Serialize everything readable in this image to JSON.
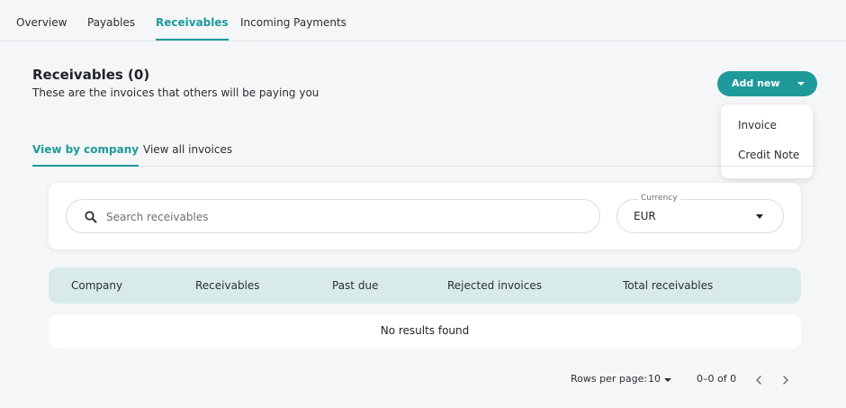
{
  "top_tabs": [
    {
      "label": "Overview"
    },
    {
      "label": "Payables"
    },
    {
      "label": "Receivables"
    },
    {
      "label": "Incoming Payments"
    }
  ],
  "active_top_tab": "Receivables",
  "header": {
    "title": "Receivables (0)",
    "subtitle": "These are the invoices that others will be paying you"
  },
  "add_new": {
    "label": "Add new",
    "menu": [
      "Invoice",
      "Credit Note"
    ]
  },
  "sub_tabs": [
    {
      "label": "View by company"
    },
    {
      "label": "View all invoices"
    }
  ],
  "search": {
    "placeholder": "Search receivables",
    "value": ""
  },
  "currency": {
    "label": "Currency",
    "value": "EUR"
  },
  "table": {
    "columns": [
      "Company",
      "Receivables",
      "Past due",
      "Rejected invoices",
      "Total receivables"
    ],
    "empty_message": "No results found"
  },
  "pagination": {
    "rows_label": "Rows per page:",
    "rows_value": "10",
    "range": "0–0 of 0"
  },
  "colors": {
    "accent": "#1e9a9a",
    "table_header_bg": "#d9ebe9",
    "page_bg": "#f5f6f8"
  },
  "icons": {
    "search": "search-icon",
    "dropdown": "chevron-down-icon",
    "prev": "chevron-left-icon",
    "next": "chevron-right-icon"
  }
}
